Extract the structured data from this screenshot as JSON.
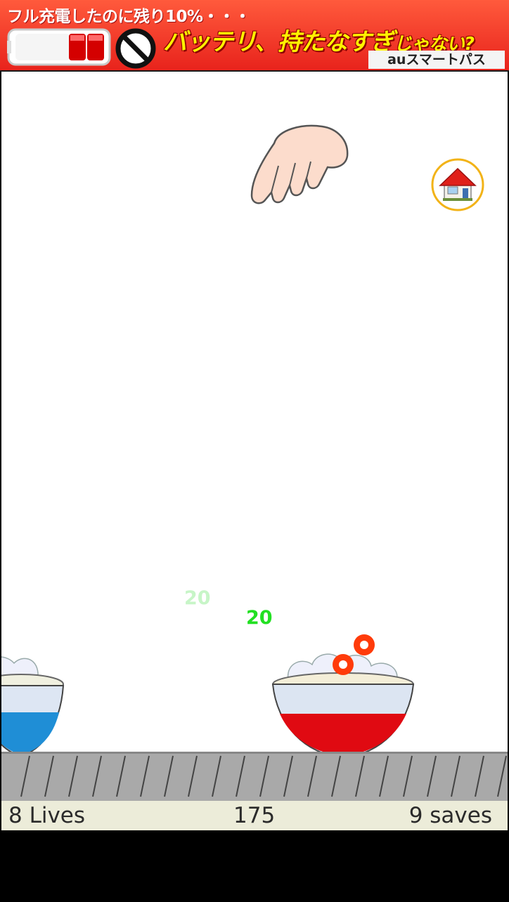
{
  "ad": {
    "top_text": "フル充電したのに残り10%・・・",
    "main_text": "バッテリ、持たなすぎ",
    "main_suffix": "じゃない?",
    "brand": "auスマートパス"
  },
  "popups": [
    {
      "text": "20",
      "faded": true
    },
    {
      "text": "20",
      "faded": false
    }
  ],
  "status": {
    "lives": "8 Lives",
    "score": "175",
    "saves": "9 saves"
  },
  "colors": {
    "ad_red": "#e8231c",
    "bowl_blue": "#1f8ed6",
    "bowl_red": "#e00a12",
    "score_green": "#22e022",
    "status_bg": "#ececd9",
    "home_ring": "#f2b318"
  },
  "icons": {
    "home": "house-icon",
    "hand": "pointing-hand-icon",
    "battery": "battery-icon",
    "prohibited": "no-sign-icon"
  }
}
